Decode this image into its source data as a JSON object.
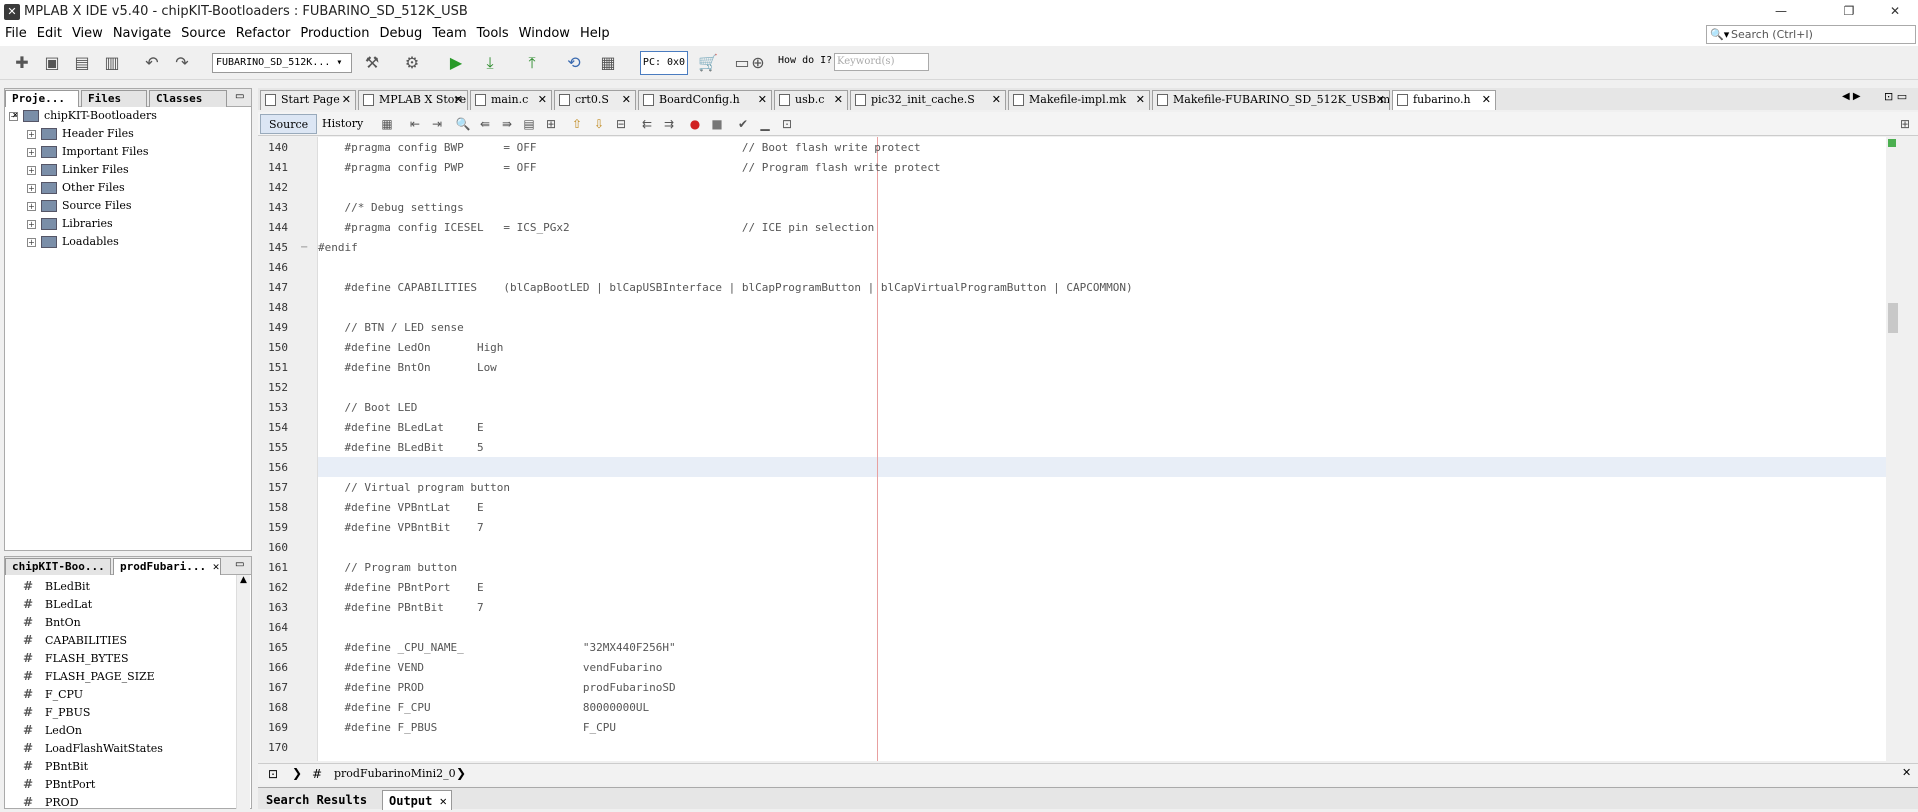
{
  "window": {
    "title": "MPLAB X IDE v5.40 - chipKIT-Bootloaders : FUBARINO_SD_512K_USB",
    "minimize": "—",
    "maximize": "❐",
    "close": "✕"
  },
  "menu": [
    "File",
    "Edit",
    "View",
    "Navigate",
    "Source",
    "Refactor",
    "Production",
    "Debug",
    "Team",
    "Tools",
    "Window",
    "Help"
  ],
  "search": {
    "placeholder": "Search (Ctrl+I)"
  },
  "toolbar": {
    "config": "FUBARINO_SD_512K...",
    "pc": "PC: 0x0",
    "how_do_i": "How do I?",
    "keyword_placeholder": "Keyword(s)"
  },
  "project_pane": {
    "tabs": [
      "Proje...",
      "Files",
      "Classes"
    ],
    "root": "chipKIT-Bootloaders",
    "folders": [
      "Header Files",
      "Important Files",
      "Linker Files",
      "Other Files",
      "Source Files",
      "Libraries",
      "Loadables"
    ]
  },
  "navigator_pane": {
    "tabs": [
      "chipKIT-Boo...",
      "prodFubari..."
    ],
    "items": [
      "BLedBit",
      "BLedLat",
      "BntOn",
      "CAPABILITIES",
      "FLASH_BYTES",
      "FLASH_PAGE_SIZE",
      "F_CPU",
      "F_PBUS",
      "LedOn",
      "LoadFlashWaitStates",
      "PBntBit",
      "PBntPort",
      "PROD"
    ]
  },
  "editor": {
    "tabs": [
      "Start Page",
      "MPLAB X Store",
      "main.c",
      "crt0.S",
      "BoardConfig.h",
      "usb.c",
      "pic32_init_cache.S",
      "Makefile-impl.mk",
      "Makefile-FUBARINO_SD_512K_USB.mk",
      "fubarino.h"
    ],
    "subtabs": [
      "Source",
      "History"
    ],
    "lines": [
      {
        "n": "140",
        "text": "    #pragma config BWP      = OFF                               // Boot flash write protect"
      },
      {
        "n": "141",
        "text": "    #pragma config PWP      = OFF                               // Program flash write protect"
      },
      {
        "n": "142",
        "text": ""
      },
      {
        "n": "143",
        "text": "    //* Debug settings"
      },
      {
        "n": "144",
        "text": "    #pragma config ICESEL   = ICS_PGx2                          // ICE pin selection"
      },
      {
        "n": "145",
        "text": "#endif"
      },
      {
        "n": "146",
        "text": ""
      },
      {
        "n": "147",
        "text": "    #define CAPABILITIES    (blCapBootLED | blCapUSBInterface | blCapProgramButton | blCapVirtualProgramButton | CAPCOMMON)"
      },
      {
        "n": "148",
        "text": ""
      },
      {
        "n": "149",
        "text": "    // BTN / LED sense"
      },
      {
        "n": "150",
        "text": "    #define LedOn       High"
      },
      {
        "n": "151",
        "text": "    #define BntOn       Low"
      },
      {
        "n": "152",
        "text": ""
      },
      {
        "n": "153",
        "text": "    // Boot LED"
      },
      {
        "n": "154",
        "text": "    #define BLedLat     E"
      },
      {
        "n": "155",
        "text": "    #define BLedBit     5"
      },
      {
        "n": "156",
        "text": ""
      },
      {
        "n": "157",
        "text": "    // Virtual program button"
      },
      {
        "n": "158",
        "text": "    #define VPBntLat    E"
      },
      {
        "n": "159",
        "text": "    #define VPBntBit    7"
      },
      {
        "n": "160",
        "text": ""
      },
      {
        "n": "161",
        "text": "    // Program button"
      },
      {
        "n": "162",
        "text": "    #define PBntPort    E"
      },
      {
        "n": "163",
        "text": "    #define PBntBit     7"
      },
      {
        "n": "164",
        "text": ""
      },
      {
        "n": "165",
        "text": "    #define _CPU_NAME_                  \"32MX440F256H\""
      },
      {
        "n": "166",
        "text": "    #define VEND                        vendFubarino"
      },
      {
        "n": "167",
        "text": "    #define PROD                        prodFubarinoSD"
      },
      {
        "n": "168",
        "text": "    #define F_CPU                       80000000UL"
      },
      {
        "n": "169",
        "text": "    #define F_PBUS                      F_CPU"
      },
      {
        "n": "170",
        "text": ""
      }
    ],
    "breadcrumb": "prodFubarinoMini2_0"
  },
  "bottom_tabs": [
    "Search Results",
    "Output"
  ],
  "colors": {
    "accent": "#4a7cc0",
    "highlight": "#e8eef7",
    "margin": "#e8a0a0"
  }
}
